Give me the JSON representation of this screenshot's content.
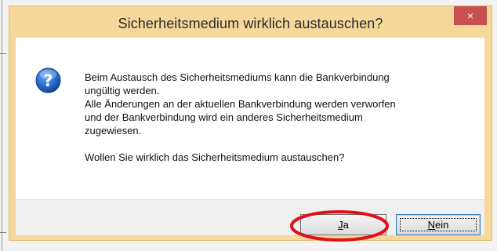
{
  "dialog": {
    "title": "Sicherheitsmedium wirklich austauschen?",
    "close_glyph": "×",
    "icon": "question-icon",
    "icon_glyph": "?",
    "message": {
      "line1": "Beim Austausch des Sicherheitsmediums kann die Bankverbindung",
      "line2": "ungültig werden.",
      "line3": "Alle Änderungen an der aktuellen Bankverbindung werden verworfen",
      "line4": "und der Bankverbindung wird ein anderes Sicherheitsmedium",
      "line5": "zugewiesen.",
      "question": "Wollen Sie wirklich das Sicherheitsmedium austauschen?"
    },
    "buttons": {
      "yes": {
        "mnemonic": "J",
        "rest": "a"
      },
      "no": {
        "mnemonic": "N",
        "rest": "ein"
      }
    }
  },
  "annotation": {
    "color": "#e0101a"
  },
  "colors": {
    "title_bar": "#f6d89a",
    "close_button": "#c75050",
    "icon_blue": "#1f5fb8"
  }
}
